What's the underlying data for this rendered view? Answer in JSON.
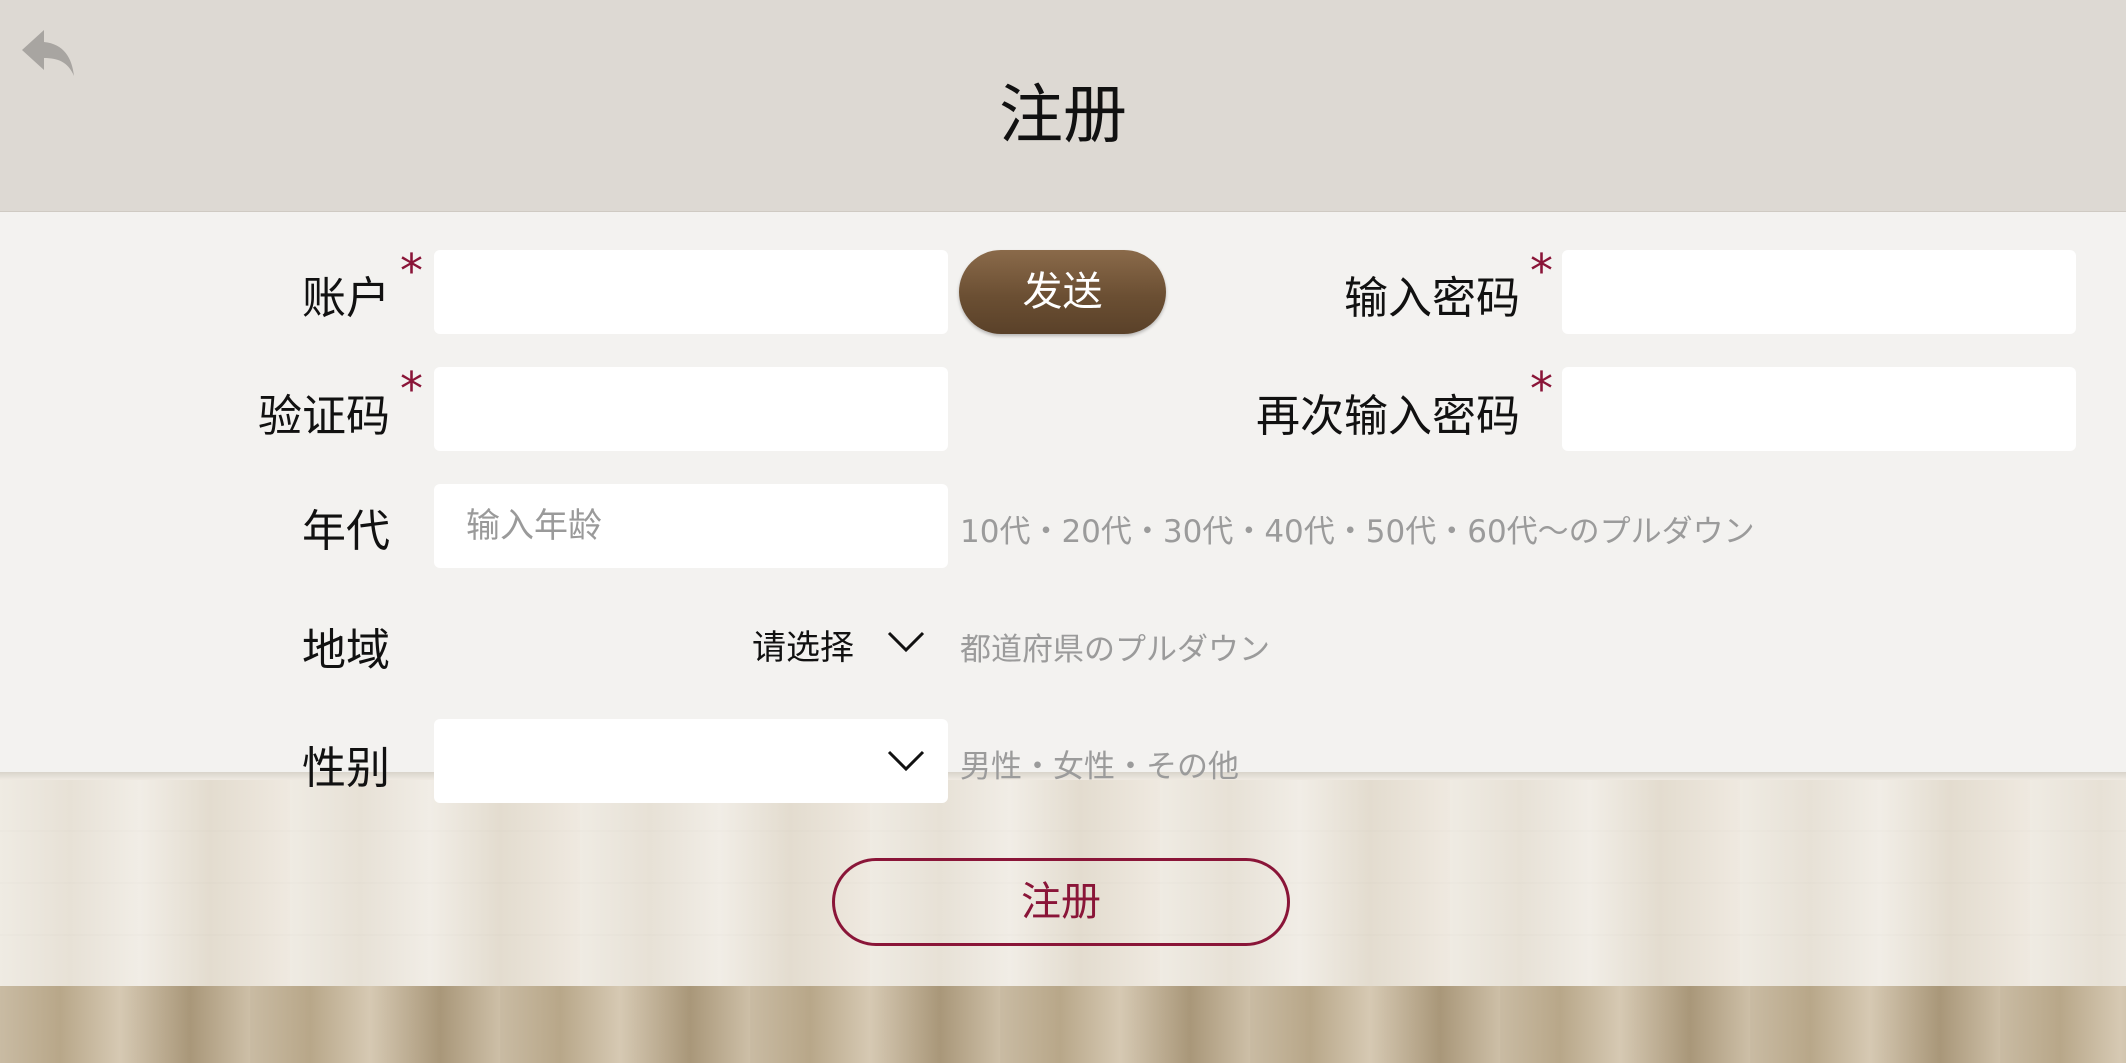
{
  "header": {
    "title": "注册",
    "back_icon": "back-arrow-icon"
  },
  "form": {
    "account": {
      "label": "账户",
      "required_mark": "*",
      "value": ""
    },
    "send_button": "发送",
    "code": {
      "label": "验证码",
      "required_mark": "*",
      "value": ""
    },
    "password": {
      "label": "输入密码",
      "required_mark": "*",
      "value": ""
    },
    "password_confirm": {
      "label": "再次输入密码",
      "required_mark": "*",
      "value": ""
    },
    "age": {
      "label": "年代",
      "placeholder": "输入年龄",
      "hint": "10代・20代・30代・40代・50代・60代〜のプルダウン"
    },
    "region": {
      "label": "地域",
      "selected": "请选择",
      "hint": "都道府県のプルダウン"
    },
    "gender": {
      "label": "性别",
      "selected": "",
      "hint": "男性・女性・その他"
    },
    "register_button": "注册"
  },
  "colors": {
    "accent": "#8a1538",
    "send_button": "#6b4f33",
    "header_bg": "#ddd9d3"
  }
}
